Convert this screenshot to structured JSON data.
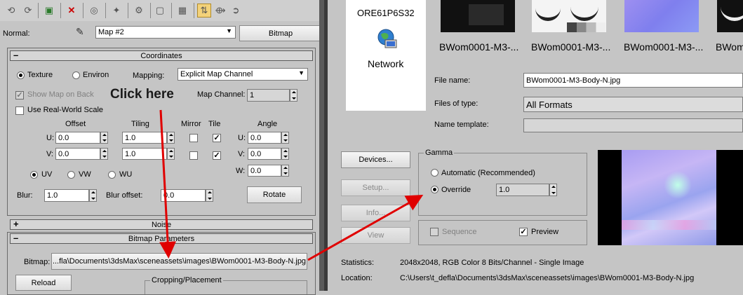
{
  "material_editor": {
    "normal_label": "Normal:",
    "map_name": "Map #2",
    "map_type": "Bitmap",
    "coordinates": {
      "title": "Coordinates",
      "texture_label": "Texture",
      "environ_label": "Environ",
      "mapping_label": "Mapping:",
      "mapping_value": "Explicit Map Channel",
      "show_map_on_back": "Show Map on Back",
      "map_channel_label": "Map Channel:",
      "map_channel_value": "1",
      "use_real_world": "Use Real-World Scale",
      "col_offset": "Offset",
      "col_tiling": "Tiling",
      "col_mirror": "Mirror",
      "col_tile": "Tile",
      "col_angle": "Angle",
      "u_label": "U:",
      "v_label": "V:",
      "w_label": "W:",
      "u_offset": "0.0",
      "v_offset": "0.0",
      "u_tiling": "1.0",
      "v_tiling": "1.0",
      "u_angle": "0.0",
      "v_angle": "0.0",
      "w_angle": "0.0",
      "uv_label": "UV",
      "vw_label": "VW",
      "wu_label": "WU",
      "blur_label": "Blur:",
      "blur_value": "1.0",
      "blur_offset_label": "Blur offset:",
      "blur_offset_value": "0.0",
      "rotate_label": "Rotate"
    },
    "noise_title": "Noise",
    "bitmap_params": {
      "title": "Bitmap Parameters",
      "bitmap_label": "Bitmap:",
      "bitmap_path": "...fla\\Documents\\3dsMax\\sceneassets\\images\\BWom0001-M3-Body-N.jpg",
      "reload_label": "Reload",
      "cropping_label": "Cropping/Placement"
    }
  },
  "annotation": {
    "text": "Click here"
  },
  "file_dialog": {
    "places": {
      "computer_name": "ORE61P6S32",
      "network_label": "Network"
    },
    "thumbnails": [
      {
        "label": "BWom0001-M3-..."
      },
      {
        "label": "BWom0001-M3-..."
      },
      {
        "label": "BWom0001-M3-..."
      },
      {
        "label": "BWom0"
      }
    ],
    "file_name_label": "File name:",
    "file_name_value": "BWom0001-M3-Body-N.jpg",
    "files_of_type_label": "Files of type:",
    "files_of_type_value": "All Formats",
    "name_template_label": "Name template:",
    "devices_label": "Devices...",
    "setup_label": "Setup...",
    "info_label": "Info...",
    "view_label": "View",
    "gamma": {
      "title": "Gamma",
      "automatic_label": "Automatic (Recommended)",
      "override_label": "Override",
      "override_value": "1.0"
    },
    "sequence_label": "Sequence",
    "preview_label": "Preview",
    "statistics_label": "Statistics:",
    "statistics_value": "2048x2048, RGB Color 8 Bits/Channel - Single Image",
    "location_label": "Location:",
    "location_value": "C:\\Users\\t_defla\\Documents\\3dsMax\\sceneassets\\images\\BWom0001-M3-Body-N.jpg"
  }
}
